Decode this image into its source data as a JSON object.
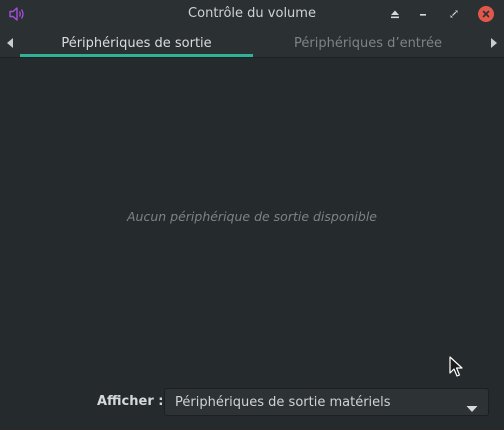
{
  "window": {
    "title": "Contrôle du volume",
    "app_icon": "speaker-icon",
    "controls": [
      "eject-icon",
      "minimize-icon",
      "restore-icon",
      "close-icon"
    ]
  },
  "tabs": [
    {
      "label": "Périphériques de sortie",
      "active": true
    },
    {
      "label": "Périphériques d’entrée",
      "active": false
    }
  ],
  "content": {
    "empty_message": "Aucun périphérique de sortie disponible"
  },
  "footer": {
    "show_label": "Afficher :",
    "show_select_value": "Périphériques de sortie matériels"
  },
  "colors": {
    "accent": "#2eb398",
    "app_icon": "#a64ee0",
    "close": "#e2574c"
  }
}
